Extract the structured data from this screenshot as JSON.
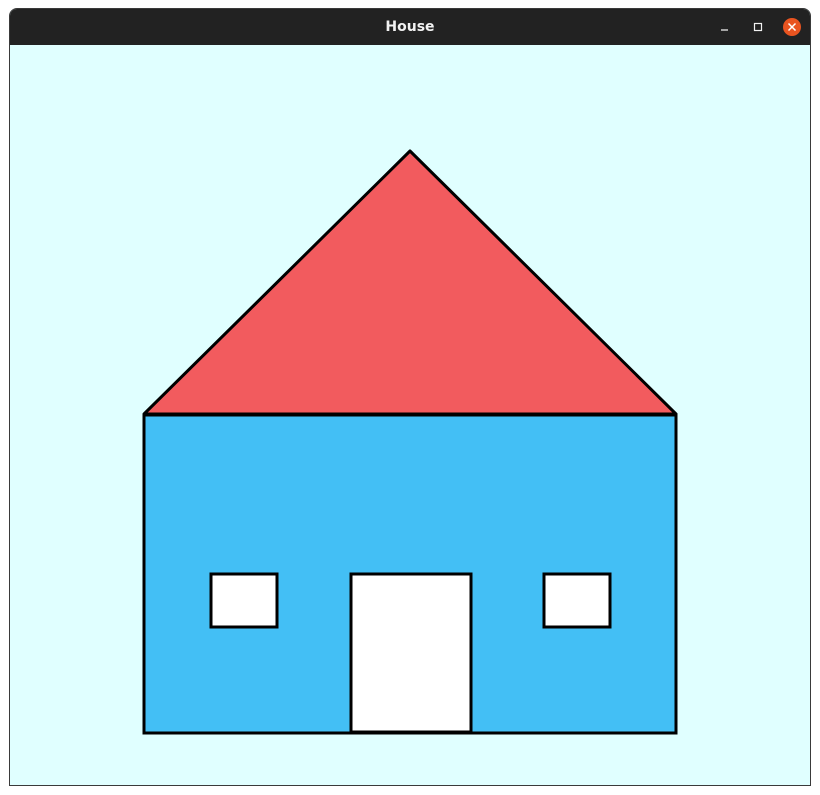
{
  "window": {
    "title": "House",
    "controls": [
      "minimize-icon",
      "maximize-icon",
      "close-icon"
    ]
  },
  "colors": {
    "background": "#e0ffff",
    "roof": "#f25b5e",
    "wall": "#43bff5",
    "window": "#ffffff",
    "door": "#ffffff",
    "outline": "#000000",
    "titlebar": "#222222",
    "close_button": "#e95420"
  }
}
